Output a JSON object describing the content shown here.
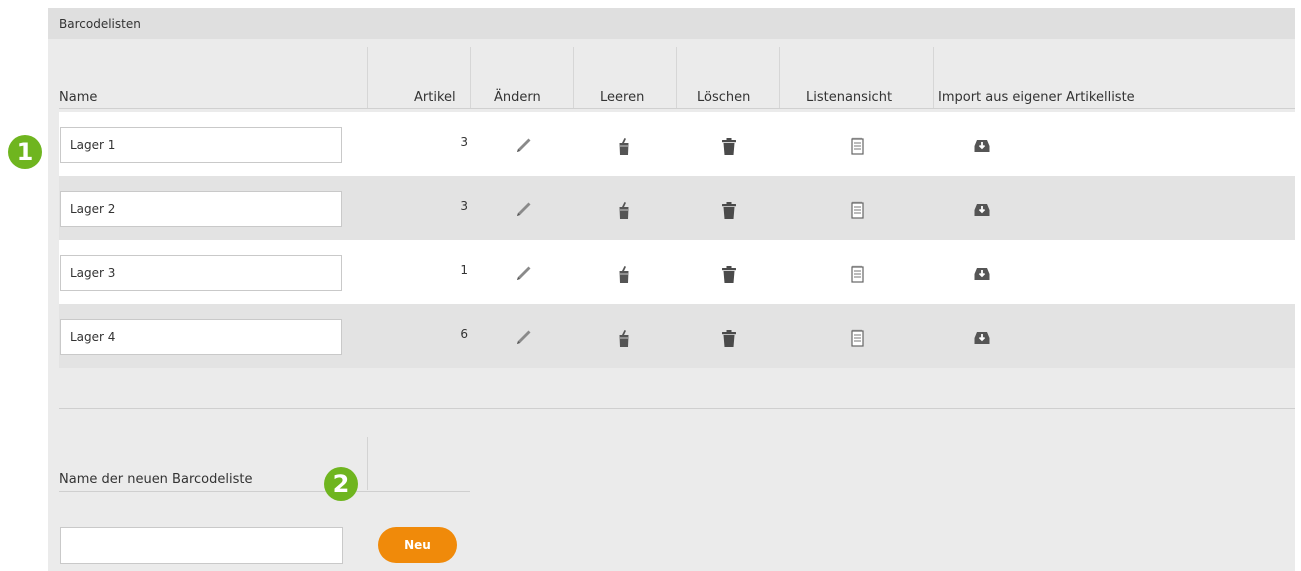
{
  "panel": {
    "title": "Barcodelisten"
  },
  "table": {
    "columns": {
      "name": "Name",
      "artikel": "Artikel",
      "aendern": "Ändern",
      "leeren": "Leeren",
      "loeschen": "Löschen",
      "listenansicht": "Listenansicht",
      "import": "Import aus eigener Artikelliste"
    },
    "rows": [
      {
        "name": "Lager 1",
        "count": "3"
      },
      {
        "name": "Lager 2",
        "count": "3"
      },
      {
        "name": "Lager 3",
        "count": "1"
      },
      {
        "name": "Lager 4",
        "count": "6"
      }
    ]
  },
  "new_list": {
    "label": "Name der neuen Barcodeliste",
    "input_value": "",
    "button_label": "Neu"
  },
  "badges": {
    "first": "1",
    "second": "2"
  },
  "icons": {
    "edit": "pencil-icon",
    "empty": "broom-icon",
    "delete": "trash-icon",
    "view": "notepad-icon",
    "import": "inbox-download-icon"
  },
  "colors": {
    "accent_button": "#f08a0a",
    "badge": "#6fb51f",
    "row_alt": "#e3e3e3",
    "panel": "#ebebeb"
  }
}
